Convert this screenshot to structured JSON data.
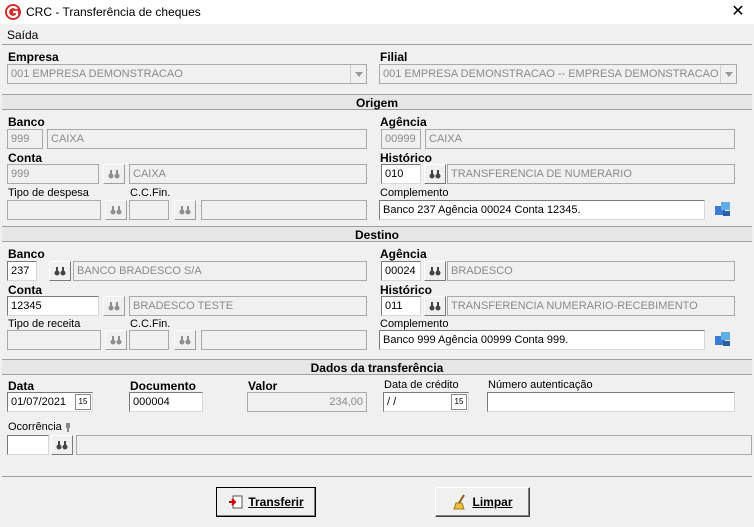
{
  "window": {
    "title": "CRC - Transferência de cheques",
    "close_glyph": "✕"
  },
  "menu": {
    "items": [
      "Saída"
    ]
  },
  "empresa": {
    "label": "Empresa",
    "value": "001 EMPRESA DEMONSTRACAO"
  },
  "filial": {
    "label": "Filial",
    "value": "001 EMPRESA DEMONSTRACAO -- EMPRESA DEMONSTRACAO"
  },
  "origem": {
    "title": "Origem",
    "banco_label": "Banco",
    "banco_code": "999",
    "banco_name": "CAIXA",
    "agencia_label": "Agência",
    "agencia_code": "00999",
    "agencia_name": "CAIXA",
    "conta_label": "Conta",
    "conta_code": "999",
    "conta_name": "CAIXA",
    "historico_label": "Histórico",
    "historico_code": "010",
    "historico_name": "TRANSFERENCIA DE NUMERARIO",
    "tipo_label": "Tipo de despesa",
    "ccfin_label": "C.C.Fin.",
    "complemento_label": "Complemento",
    "complemento_value": "Banco 237 Agência 00024 Conta 12345."
  },
  "destino": {
    "title": "Destino",
    "banco_label": "Banco",
    "banco_code": "237",
    "banco_name": "BANCO BRADESCO S/A",
    "agencia_label": "Agência",
    "agencia_code": "00024",
    "agencia_name": "BRADESCO",
    "conta_label": "Conta",
    "conta_code": "12345",
    "conta_name": "BRADESCO TESTE",
    "historico_label": "Histórico",
    "historico_code": "011",
    "historico_name": "TRANSFERENCIA NUMERARIO-RECEBIMENTO",
    "tipo_label": "Tipo de receita",
    "ccfin_label": "C.C.Fin.",
    "complemento_label": "Complemento",
    "complemento_value": "Banco 999 Agência 00999 Conta 999."
  },
  "dados": {
    "title": "Dados da transferência",
    "data_label": "Data",
    "data_value": "01/07/2021",
    "documento_label": "Documento",
    "documento_value": "000004",
    "valor_label": "Valor",
    "valor_value": "234,00",
    "credito_label": "Data de crédito",
    "credito_value": " / /",
    "autent_label": "Número autenticação",
    "autent_value": "",
    "ocorrencia_label": "Ocorrência"
  },
  "buttons": {
    "transferir": "Transferir",
    "limpar": "Limpar"
  }
}
